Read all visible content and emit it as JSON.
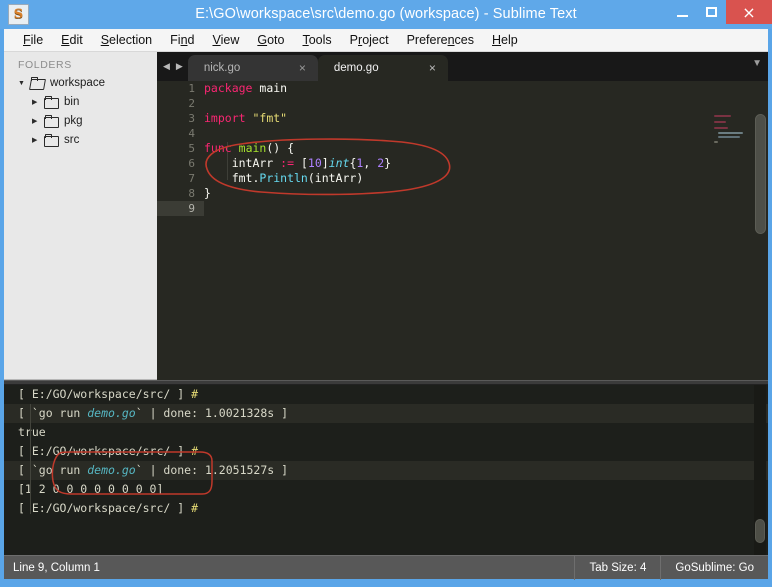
{
  "window": {
    "title": "E:\\GO\\workspace\\src\\demo.go (workspace) - Sublime Text",
    "icon": "sublime-app-icon",
    "minimize_label": "–",
    "maximize_label": "❐",
    "close_label": "×"
  },
  "menubar": {
    "items": [
      {
        "pre": "",
        "accel": "F",
        "post": "ile"
      },
      {
        "pre": "",
        "accel": "E",
        "post": "dit"
      },
      {
        "pre": "",
        "accel": "S",
        "post": "election"
      },
      {
        "pre": "Fi",
        "accel": "n",
        "post": "d"
      },
      {
        "pre": "",
        "accel": "V",
        "post": "iew"
      },
      {
        "pre": "",
        "accel": "G",
        "post": "oto"
      },
      {
        "pre": "",
        "accel": "T",
        "post": "ools"
      },
      {
        "pre": "P",
        "accel": "r",
        "post": "oject"
      },
      {
        "pre": "Prefere",
        "accel": "n",
        "post": "ces"
      },
      {
        "pre": "",
        "accel": "H",
        "post": "elp"
      }
    ]
  },
  "sidebar": {
    "header": "FOLDERS",
    "tree": [
      {
        "label": "workspace",
        "level": 0,
        "expanded": true,
        "icon": "folder-open-icon"
      },
      {
        "label": "bin",
        "level": 1,
        "expanded": false,
        "icon": "folder-icon"
      },
      {
        "label": "pkg",
        "level": 1,
        "expanded": false,
        "icon": "folder-icon"
      },
      {
        "label": "src",
        "level": 1,
        "expanded": false,
        "icon": "folder-icon"
      }
    ]
  },
  "tabs": {
    "prev_label": "◀",
    "next_label": "▶",
    "dropdown_label": "▼",
    "close_label": "×",
    "items": [
      {
        "name": "nick.go",
        "active": false
      },
      {
        "name": "demo.go",
        "active": true
      }
    ]
  },
  "editor": {
    "line_numbers": [
      "1",
      "2",
      "3",
      "4",
      "5",
      "6",
      "7",
      "8",
      "9"
    ],
    "current_line": 9,
    "lines": [
      {
        "n": 1,
        "text": "package main"
      },
      {
        "n": 2,
        "text": ""
      },
      {
        "n": 3,
        "text": "import \"fmt\""
      },
      {
        "n": 4,
        "text": ""
      },
      {
        "n": 5,
        "text": "func main() {"
      },
      {
        "n": 6,
        "text": "    intArr := [10]int{1, 2}"
      },
      {
        "n": 7,
        "text": "    fmt.Println(intArr)"
      },
      {
        "n": 8,
        "text": "}"
      },
      {
        "n": 9,
        "text": ""
      }
    ]
  },
  "console": {
    "lines": [
      {
        "text": "[ E:/GO/workspace/src/ ] #",
        "alt": false
      },
      {
        "text": "[ `go run demo.go` | done: 1.0021328s ]",
        "alt": true
      },
      {
        "text": "true",
        "alt": false
      },
      {
        "text": "[ E:/GO/workspace/src/ ] #",
        "alt": false
      },
      {
        "text": "[ `go run demo.go` | done: 1.2051527s ]",
        "alt": true
      },
      {
        "text": "[1 2 0 0 0 0 0 0 0 0]",
        "alt": false
      },
      {
        "text": "[ E:/GO/workspace/src/ ] #",
        "alt": false
      }
    ]
  },
  "statusbar": {
    "position": "Line 9, Column 1",
    "tab_size": "Tab Size: 4",
    "syntax": "GoSublime: Go"
  },
  "colors": {
    "titlebar": "#5fa8e9",
    "close_button": "#d9534f",
    "editor_bg": "#272822",
    "console_bg": "#1d1f1b",
    "keyword": "#f92672",
    "function": "#a6e22e",
    "string": "#e6db74",
    "number": "#ae81ff",
    "type": "#66d9ef",
    "annotation": "#c0392b",
    "statusbar": "#585858"
  }
}
